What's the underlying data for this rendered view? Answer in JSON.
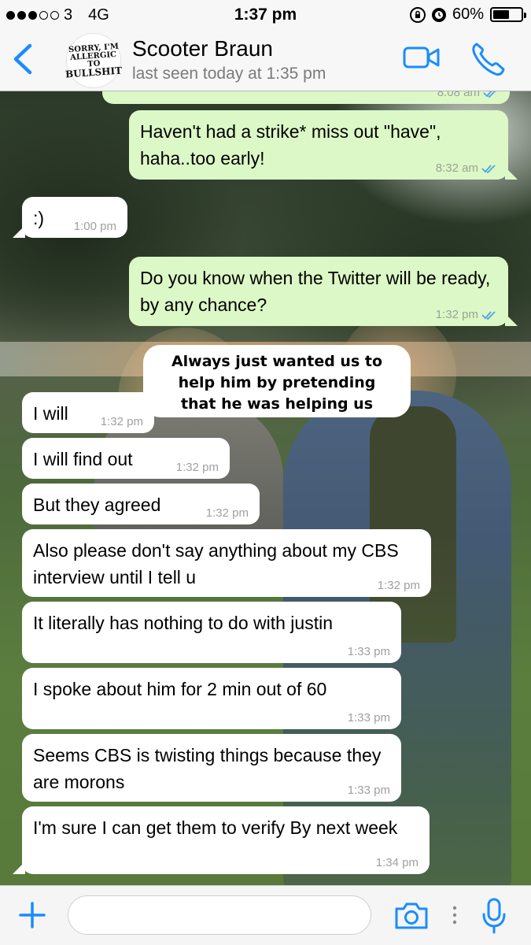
{
  "status_bar": {
    "carrier": "3",
    "network": "4G",
    "time": "1:37 pm",
    "battery": "60%",
    "battery_level": 0.6
  },
  "header": {
    "avatar_text": [
      "SORRY, I'M",
      "ALLERGIC TO",
      "BULLSHIT"
    ],
    "contact_name": "Scooter Braun",
    "last_seen": "last seen today at 1:35 pm"
  },
  "colors": {
    "accent": "#1a8cff",
    "outgoing_bubble": "#dcf8c6",
    "incoming_bubble": "#ffffff",
    "read_ticks": "#4fa3e8"
  },
  "messages": [
    {
      "dir": "out",
      "text": "",
      "time": "8:08 am",
      "read": true
    },
    {
      "dir": "out",
      "text": "Haven't had a strike* miss out \"have\", haha..too early!",
      "time": "8:32 am",
      "read": true
    },
    {
      "dir": "in",
      "text": ":)",
      "time": "1:00 pm"
    },
    {
      "dir": "out",
      "text": "Do you know when the Twitter will be ready, by any chance?",
      "time": "1:32 pm",
      "read": true
    },
    {
      "dir": "in",
      "text": "I will",
      "time": "1:32 pm"
    },
    {
      "dir": "in",
      "text": "I will find out",
      "time": "1:32 pm"
    },
    {
      "dir": "in",
      "text": "But they agreed",
      "time": "1:32 pm"
    },
    {
      "dir": "in",
      "text": "Also please don't say anything about my CBS interview until I tell u",
      "time": "1:32 pm"
    },
    {
      "dir": "in",
      "text": "It literally has nothing to do with justin",
      "time": "1:33 pm"
    },
    {
      "dir": "in",
      "text": "I spoke about him for 2 min out of 60",
      "time": "1:33 pm"
    },
    {
      "dir": "in",
      "text": "Seems CBS is twisting things because they are morons",
      "time": "1:33 pm"
    },
    {
      "dir": "in",
      "text": "I'm sure I can get them to verify By next week",
      "time": "1:34 pm"
    }
  ],
  "overlay_caption": [
    "Always just wanted us to",
    "help him by pretending",
    "that he was helping us"
  ],
  "input_bar": {
    "message_value": ""
  }
}
